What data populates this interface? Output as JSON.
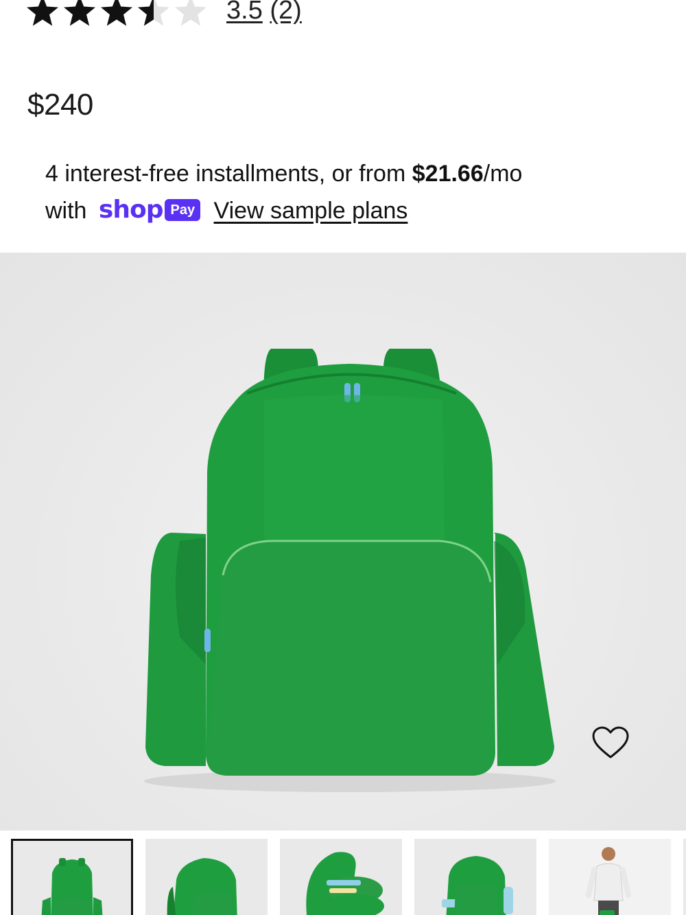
{
  "rating": {
    "value": "3.5",
    "count": "(2)",
    "stars_filled": 3.5,
    "stars_total": 5
  },
  "price": "$240",
  "installments": {
    "text_before": "4 interest-free installments, or from ",
    "amount": "$21.66",
    "text_after": "/mo",
    "with": "with",
    "shop_word": "shop",
    "pay_word": "Pay",
    "link": "View sample plans"
  },
  "product_image": {
    "subject": "green backpack",
    "icon_wishlist": "heart-icon"
  },
  "thumbnails": [
    {
      "name": "backpack front",
      "active": true
    },
    {
      "name": "backpack angled",
      "active": false
    },
    {
      "name": "backpack open",
      "active": false
    },
    {
      "name": "backpack with contents",
      "active": false
    },
    {
      "name": "model with backpack",
      "active": false
    }
  ],
  "colors": {
    "shop_purple": "#5a31f4",
    "backpack_green": "#1e9b3e",
    "backpack_dark": "#17812f"
  }
}
